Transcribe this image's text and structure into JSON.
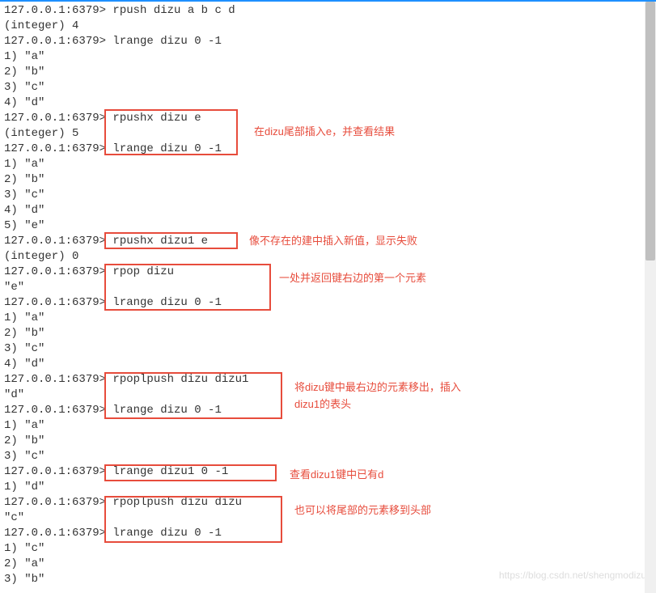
{
  "lines": [
    "127.0.0.1:6379> rpush dizu a b c d",
    "(integer) 4",
    "127.0.0.1:6379> lrange dizu 0 -1",
    "1) \"a\"",
    "2) \"b\"",
    "3) \"c\"",
    "4) \"d\"",
    "127.0.0.1:6379> rpushx dizu e",
    "(integer) 5",
    "127.0.0.1:6379> lrange dizu 0 -1",
    "1) \"a\"",
    "2) \"b\"",
    "3) \"c\"",
    "4) \"d\"",
    "5) \"e\"",
    "127.0.0.1:6379> rpushx dizu1 e",
    "(integer) 0",
    "127.0.0.1:6379> rpop dizu",
    "\"e\"",
    "127.0.0.1:6379> lrange dizu 0 -1",
    "1) \"a\"",
    "2) \"b\"",
    "3) \"c\"",
    "4) \"d\"",
    "127.0.0.1:6379> rpoplpush dizu dizu1",
    "\"d\"",
    "127.0.0.1:6379> lrange dizu 0 -1",
    "1) \"a\"",
    "2) \"b\"",
    "3) \"c\"",
    "127.0.0.1:6379> lrange dizu1 0 -1",
    "1) \"d\"",
    "127.0.0.1:6379> rpoplpush dizu dizu",
    "\"c\"",
    "127.0.0.1:6379> lrange dizu 0 -1",
    "1) \"c\"",
    "2) \"a\"",
    "3) \"b\""
  ],
  "annotations": [
    "在dizu尾部插入e，并查看结果",
    "像不存在的建中插入新值，显示失败",
    "一处并返回键右边的第一个元素",
    "将dizu键中最右边的元素移出，插入dizu1的表头",
    "查看dizu1键中已有d",
    "也可以将尾部的元素移到头部"
  ],
  "watermark": "https://blog.csdn.net/shengmodizu"
}
